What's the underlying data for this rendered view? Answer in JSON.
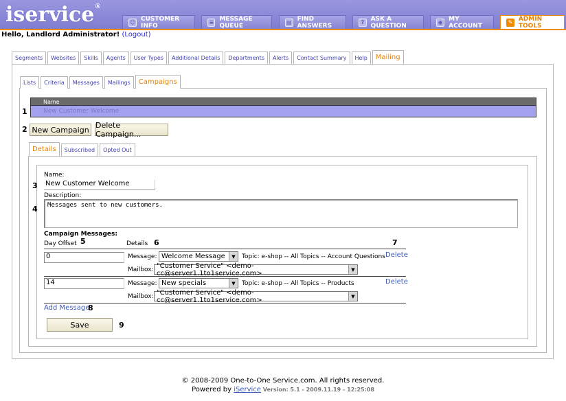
{
  "header": {
    "logo": "iservice",
    "logo_mark": "®",
    "nav": [
      {
        "label": "CUSTOMER INFO",
        "icon": "customer-icon"
      },
      {
        "label": "MESSAGE QUEUE",
        "icon": "queue-icon"
      },
      {
        "label": "FIND ANSWERS",
        "icon": "book-icon"
      },
      {
        "label": "ASK A QUESTION",
        "icon": "question-icon"
      },
      {
        "label": "MY ACCOUNT",
        "icon": "account-icon"
      },
      {
        "label": "ADMIN TOOLS",
        "icon": "wrench-icon"
      }
    ]
  },
  "greeting": {
    "text": "Hello, Landlord Administrator!",
    "logout": "(Logout)"
  },
  "admin_tabs": [
    "Segments",
    "Websites",
    "Skills",
    "Agents",
    "User Types",
    "Additional Details",
    "Departments",
    "Alerts",
    "Contact Summary",
    "Help",
    "Mailing"
  ],
  "mailing_tabs": [
    "Lists",
    "Criteria",
    "Messages",
    "Mailings",
    "Campaigns"
  ],
  "campaigns": {
    "column": "Name",
    "rows": [
      "New Customer Welcome"
    ],
    "new_btn": "New Campaign",
    "delete_btn": "Delete Campaign..."
  },
  "detail_tabs": [
    "Details",
    "Subscribed",
    "Opted Out"
  ],
  "details": {
    "name_label": "Name:",
    "name_value": "New Customer Welcome",
    "desc_label": "Description:",
    "desc_value": "Messages sent to new customers.",
    "messages_label": "Campaign Messages:",
    "col_offset": "Day Offset",
    "col_details": "Details",
    "message_label": "Message:",
    "mailbox_label": "Mailbox:",
    "entries": [
      {
        "offset": "0",
        "message": "Welcome Message",
        "topic": "Topic: e-shop -- All Topics -- Account Questions",
        "mailbox": "\"Customer Service\" <demo-cc@server1.1to1service.com>",
        "delete": "Delete"
      },
      {
        "offset": "14",
        "message": "New specials",
        "topic": "Topic: e-shop -- All Topics -- Products",
        "mailbox": "\"Customer Service\" <demo-cc@server1.1to1service.com>",
        "delete": "Delete"
      }
    ],
    "add_message": "Add Message",
    "save": "Save"
  },
  "markers": [
    "1",
    "2",
    "3",
    "4",
    "5",
    "6",
    "7",
    "8",
    "9"
  ],
  "footer": {
    "copyright": "© 2008-2009 One-to-One Service.com. All rights reserved.",
    "powered_by": "Powered by ",
    "powered_link": "iService",
    "version": " Version: 5.1 - 2009.11.19 - 12:25:08"
  }
}
